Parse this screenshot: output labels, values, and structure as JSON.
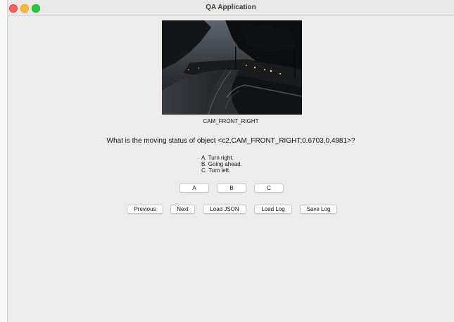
{
  "window": {
    "title": "QA Application"
  },
  "image": {
    "caption": "CAM_FRONT_RIGHT"
  },
  "question": {
    "text": "What is the moving status of object <c2,CAM_FRONT_RIGHT,0.6703,0.4981>?",
    "options": [
      "A. Turn right.",
      "B. Going ahead.",
      "C. Turn left."
    ]
  },
  "answer_buttons": [
    "A",
    "B",
    "C"
  ],
  "nav_buttons": {
    "previous": "Previous",
    "next": "Next",
    "load_json": "Load JSON",
    "load_log": "Load Log",
    "save_log": "Save Log"
  }
}
